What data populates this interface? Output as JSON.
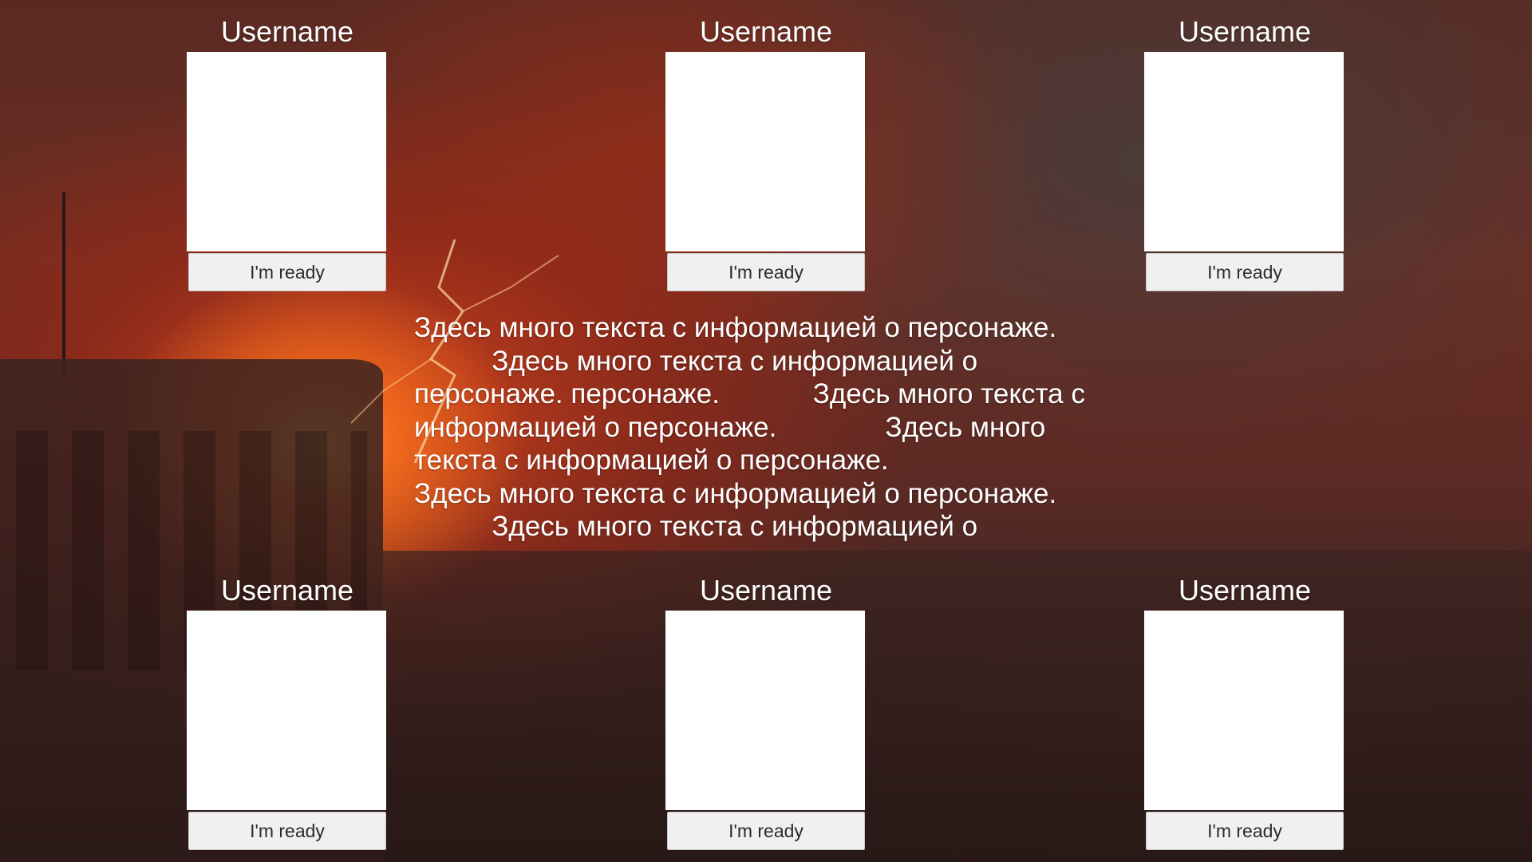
{
  "players": [
    {
      "username": "Username",
      "ready_label": "I'm ready"
    },
    {
      "username": "Username",
      "ready_label": "I'm ready"
    },
    {
      "username": "Username",
      "ready_label": "I'm ready"
    },
    {
      "username": "Username",
      "ready_label": "I'm ready"
    },
    {
      "username": "Username",
      "ready_label": "I'm ready"
    },
    {
      "username": "Username",
      "ready_label": "I'm ready"
    }
  ],
  "character_info": "Здесь много текста с информацией о персонаже.\n          Здесь много текста с информацией о\nперсонаже. персонаже.            Здесь много текста с\nинформацией о персонаже.              Здесь много\nтекста с информацией о персонаже.\nЗдесь много текста с информацией о персонаже.\n          Здесь много текста с информацией о",
  "colors": {
    "text": "#ffffff",
    "avatar_background": "#ffffff",
    "button_background": "#f0f0f0",
    "button_text": "#2b2b2b"
  }
}
